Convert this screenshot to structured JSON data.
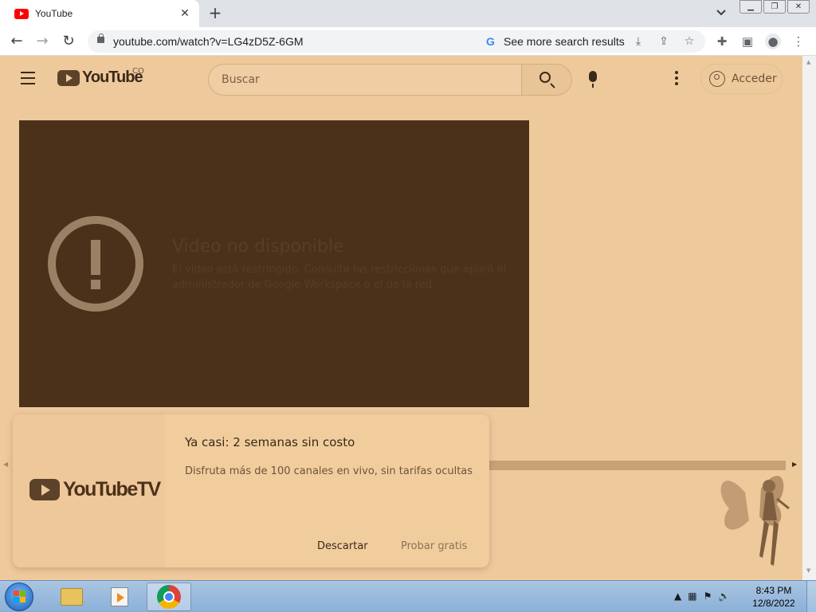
{
  "browser": {
    "tab_title": "YouTube",
    "tab_close": "✕",
    "new_tab": "+",
    "back": "←",
    "forward": "→",
    "reload": "↻",
    "url": "youtube.com/watch?v=LG4zD5Z-6GM",
    "google_letter": "G",
    "search_more": "See more search results"
  },
  "youtube": {
    "logo_text": "YouTube",
    "country": "CO",
    "search_placeholder": "Buscar",
    "signin": "Acceder"
  },
  "player": {
    "error_title": "Video no disponible",
    "error_message": "El video está restringido. Consulta las restricciones que aplicó el administrador de Google Workspace o el de la red."
  },
  "promo": {
    "logo_text": "YouTubeTV",
    "title": "Ya casi: 2 semanas sin costo",
    "subtitle": "Disfruta más de 100 canales en vivo, sin tarifas ocultas",
    "dismiss": "Descartar",
    "try_free": "Probar gratis"
  },
  "taskbar": {
    "time": "8:43 PM",
    "date": "12/8/2022"
  },
  "colors": {
    "page_bg": "#eec99c",
    "player_bg": "#4b3119",
    "accent_dark": "#3a2a18"
  }
}
